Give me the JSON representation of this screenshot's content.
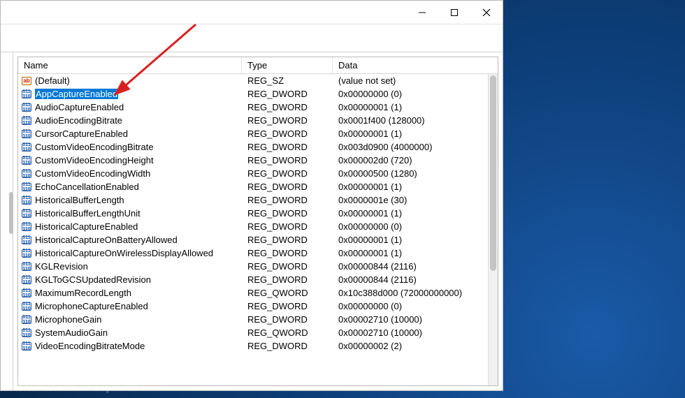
{
  "columns": {
    "name": "Name",
    "type": "Type",
    "data": "Data"
  },
  "watermark": "windowsreport",
  "rows": [
    {
      "icon": "sz",
      "name": "(Default)",
      "type": "REG_SZ",
      "data": "(value not set)",
      "selected": false
    },
    {
      "icon": "bin",
      "name": "AppCaptureEnabled",
      "type": "REG_DWORD",
      "data": "0x00000000 (0)",
      "selected": true
    },
    {
      "icon": "bin",
      "name": "AudioCaptureEnabled",
      "type": "REG_DWORD",
      "data": "0x00000001 (1)",
      "selected": false
    },
    {
      "icon": "bin",
      "name": "AudioEncodingBitrate",
      "type": "REG_DWORD",
      "data": "0x0001f400 (128000)",
      "selected": false
    },
    {
      "icon": "bin",
      "name": "CursorCaptureEnabled",
      "type": "REG_DWORD",
      "data": "0x00000001 (1)",
      "selected": false
    },
    {
      "icon": "bin",
      "name": "CustomVideoEncodingBitrate",
      "type": "REG_DWORD",
      "data": "0x003d0900 (4000000)",
      "selected": false
    },
    {
      "icon": "bin",
      "name": "CustomVideoEncodingHeight",
      "type": "REG_DWORD",
      "data": "0x000002d0 (720)",
      "selected": false
    },
    {
      "icon": "bin",
      "name": "CustomVideoEncodingWidth",
      "type": "REG_DWORD",
      "data": "0x00000500 (1280)",
      "selected": false
    },
    {
      "icon": "bin",
      "name": "EchoCancellationEnabled",
      "type": "REG_DWORD",
      "data": "0x00000001 (1)",
      "selected": false
    },
    {
      "icon": "bin",
      "name": "HistoricalBufferLength",
      "type": "REG_DWORD",
      "data": "0x0000001e (30)",
      "selected": false
    },
    {
      "icon": "bin",
      "name": "HistoricalBufferLengthUnit",
      "type": "REG_DWORD",
      "data": "0x00000001 (1)",
      "selected": false
    },
    {
      "icon": "bin",
      "name": "HistoricalCaptureEnabled",
      "type": "REG_DWORD",
      "data": "0x00000000 (0)",
      "selected": false
    },
    {
      "icon": "bin",
      "name": "HistoricalCaptureOnBatteryAllowed",
      "type": "REG_DWORD",
      "data": "0x00000001 (1)",
      "selected": false
    },
    {
      "icon": "bin",
      "name": "HistoricalCaptureOnWirelessDisplayAllowed",
      "type": "REG_DWORD",
      "data": "0x00000001 (1)",
      "selected": false
    },
    {
      "icon": "bin",
      "name": "KGLRevision",
      "type": "REG_DWORD",
      "data": "0x00000844 (2116)",
      "selected": false
    },
    {
      "icon": "bin",
      "name": "KGLToGCSUpdatedRevision",
      "type": "REG_DWORD",
      "data": "0x00000844 (2116)",
      "selected": false
    },
    {
      "icon": "bin",
      "name": "MaximumRecordLength",
      "type": "REG_QWORD",
      "data": "0x10c388d000 (72000000000)",
      "selected": false
    },
    {
      "icon": "bin",
      "name": "MicrophoneCaptureEnabled",
      "type": "REG_DWORD",
      "data": "0x00000000 (0)",
      "selected": false
    },
    {
      "icon": "bin",
      "name": "MicrophoneGain",
      "type": "REG_DWORD",
      "data": "0x00002710 (10000)",
      "selected": false
    },
    {
      "icon": "bin",
      "name": "SystemAudioGain",
      "type": "REG_QWORD",
      "data": "0x00002710 (10000)",
      "selected": false
    },
    {
      "icon": "bin",
      "name": "VideoEncodingBitrateMode",
      "type": "REG_DWORD",
      "data": "0x00000002 (2)",
      "selected": false
    }
  ]
}
